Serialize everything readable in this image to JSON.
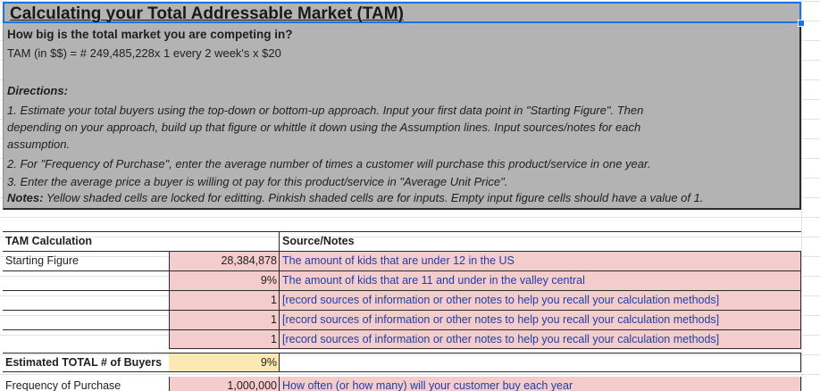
{
  "header": {
    "title": "Calculating your Total Addressable Market (TAM)",
    "subtitle": "How big is the total market you are competing in?",
    "formula": "TAM (in $$) = # 249,485,228x 1 every 2 week's x $20"
  },
  "directions": {
    "heading": "Directions:",
    "lines": [
      "1. Estimate your total buyers using the top-down or bottom-up approach. Input your first data point in \"Starting Figure\". Then",
      "depending on your approach, build up that figure or whittle it down using the Assumption lines. Input sources/notes for each",
      "assumption.",
      "2. For \"Frequency of Purchase\", enter the average number of times a customer will purchase this product/service in one year.",
      "3. Enter the average price a buyer is willing ot pay for this product/service in \"Average Unit Price\"."
    ],
    "notes_label": "Notes:",
    "notes_text": " Yellow shaded cells are locked for editting. Pinkish shaded cells are for inputs. Empty input figure cells should have a value of 1."
  },
  "table": {
    "header": {
      "label": "TAM Calculation",
      "notes": "Source/Notes"
    },
    "rows": [
      {
        "label": "Starting Figure",
        "value": "28,384,878",
        "note": "The amount of kids that are under 12 in the US"
      },
      {
        "label": "",
        "value": "9%",
        "note": "The amount of kids that are 11 and under in the valley central"
      },
      {
        "label": "",
        "value": "1",
        "note": "[record sources of information or other notes to help you recall your calculation methods]"
      },
      {
        "label": "",
        "value": "1",
        "note": "[record sources of information or other notes to help you recall your calculation methods]"
      },
      {
        "label": "",
        "value": "1",
        "note": "[record sources of information or other notes to help you recall your calculation methods]"
      }
    ],
    "total": {
      "label": "Estimated TOTAL  # of Buyers",
      "value": "9%"
    },
    "frequency": {
      "label": "Frequency of Purchase",
      "value": "1,000,000",
      "note": "How often (or how many) will your customer buy each year"
    }
  },
  "colors": {
    "input_pink": "#f4cccc",
    "locked_yellow": "#fce8b2",
    "box_grey": "#b3b3b3",
    "selection_blue": "#1a73e8",
    "note_blue": "#1f3ea6"
  }
}
